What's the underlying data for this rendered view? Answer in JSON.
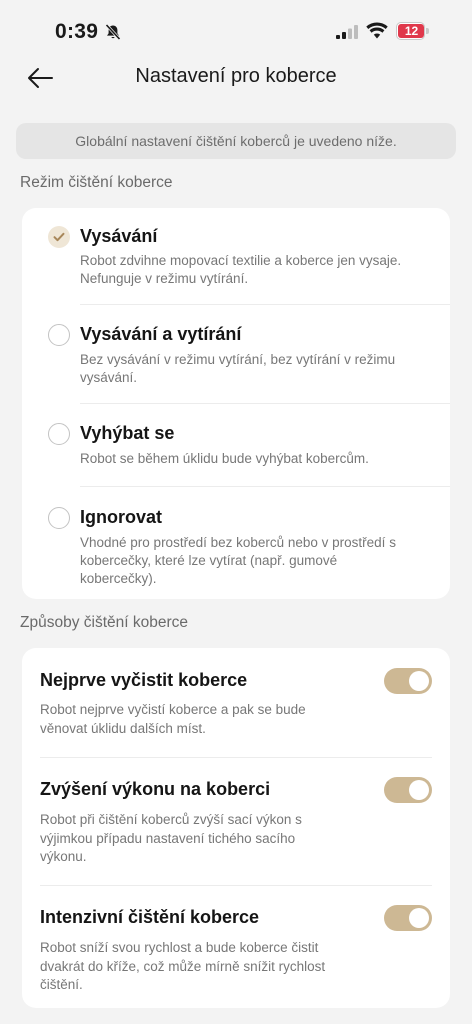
{
  "status": {
    "time": "0:39",
    "battery": "12"
  },
  "header": {
    "title": "Nastavení pro koberce"
  },
  "banner": {
    "text": "Globální nastavení čištění koberců je uvedeno níže."
  },
  "mode_section": {
    "title": "Režim čištění koberce",
    "options": [
      {
        "label": "Vysávání",
        "description": "Robot zdvihne mopovací textilie a koberce jen vysaje. Nefunguje v režimu vytírání.",
        "selected": true
      },
      {
        "label": "Vysávání a vytírání",
        "description": "Bez vysávání v režimu vytírání, bez vytírání v režimu vysávání.",
        "selected": false
      },
      {
        "label": "Vyhýbat se",
        "description": "Robot se během úklidu bude vyhýbat kobercům.",
        "selected": false
      },
      {
        "label": "Ignorovat",
        "description": "Vhodné pro prostředí bez koberců nebo v prostředí s kobercečky, které lze vytírat (např. gumové kobercečky).",
        "selected": false
      }
    ]
  },
  "methods_section": {
    "title": "Způsoby čištění koberce",
    "toggles": [
      {
        "label": "Nejprve vyčistit koberce",
        "description": "Robot nejprve vyčistí koberce a pak se bude věnovat úklidu dalších míst.",
        "on": true
      },
      {
        "label": "Zvýšení výkonu na koberci",
        "description": "Robot při čištění koberců zvýší sací výkon s výjimkou případu nastavení tichého sacího výkonu.",
        "on": true
      },
      {
        "label": "Intenzivní čištění koberce",
        "description": "Robot sníží svou rychlost a bude koberce čistit dvakrát do kříže, což může mírně snížit rychlost čištění.",
        "on": true
      }
    ]
  },
  "colors": {
    "accent": "#cdb894",
    "check": "#a8875a",
    "battery_low": "#e0384b"
  },
  "icons": {
    "back": "arrow-left-icon",
    "check": "check-icon",
    "bell": "bell-slash-icon",
    "signal": "signal-icon",
    "wifi": "wifi-icon",
    "battery": "battery-icon"
  }
}
